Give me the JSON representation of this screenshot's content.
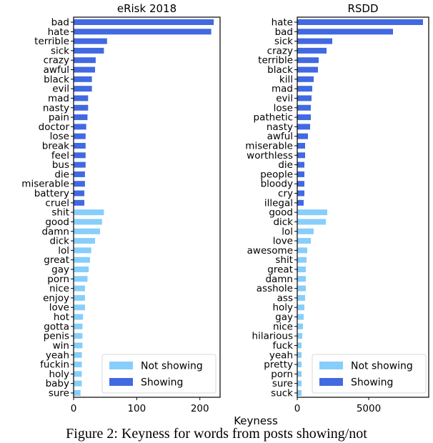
{
  "chart_data": [
    {
      "type": "bar",
      "orientation": "horizontal",
      "title": "eRisk 2018",
      "xlabel": "",
      "ylabel": "",
      "xlim": [
        0,
        232
      ],
      "xticks": [
        0,
        100,
        200
      ],
      "grid": false,
      "legend": {
        "placement": "bottom-right",
        "entries": [
          "Not showing",
          "Showing"
        ]
      },
      "categories": [
        "bad",
        "hate",
        "terrible",
        "sick",
        "crazy",
        "awful",
        "black",
        "evil",
        "mad",
        "nasty",
        "pain",
        "doctor",
        "lose",
        "break",
        "feel",
        "bus",
        "die",
        "miserable",
        "battery",
        "cruel",
        "shit",
        "good",
        "damn",
        "dick",
        "lol",
        "great",
        "gay",
        "porn",
        "nice",
        "enjoy",
        "love",
        "hot",
        "gotta",
        "penis",
        "win",
        "yeah",
        "fuckin",
        "holy",
        "baby",
        "sure"
      ],
      "values": [
        222,
        218,
        53,
        48,
        35,
        34,
        29,
        29,
        23,
        23,
        22,
        20,
        19,
        19,
        19,
        19,
        18,
        18,
        17,
        17,
        48,
        45,
        42,
        34,
        28,
        26,
        24,
        22,
        18,
        18,
        18,
        15,
        14,
        14,
        14,
        13,
        13,
        13,
        13,
        11
      ],
      "groups": [
        "Showing",
        "Showing",
        "Showing",
        "Showing",
        "Showing",
        "Showing",
        "Showing",
        "Showing",
        "Showing",
        "Showing",
        "Showing",
        "Showing",
        "Showing",
        "Showing",
        "Showing",
        "Showing",
        "Showing",
        "Showing",
        "Showing",
        "Showing",
        "Not showing",
        "Not showing",
        "Not showing",
        "Not showing",
        "Not showing",
        "Not showing",
        "Not showing",
        "Not showing",
        "Not showing",
        "Not showing",
        "Not showing",
        "Not showing",
        "Not showing",
        "Not showing",
        "Not showing",
        "Not showing",
        "Not showing",
        "Not showing",
        "Not showing",
        "Not showing"
      ]
    },
    {
      "type": "bar",
      "orientation": "horizontal",
      "title": "RSDD",
      "xlabel": "",
      "ylabel": "",
      "xlim": [
        0,
        9200
      ],
      "xticks": [
        0,
        5000
      ],
      "grid": false,
      "legend": {
        "placement": "bottom-right",
        "entries": [
          "Not showing",
          "Showing"
        ]
      },
      "categories": [
        "hate",
        "bad",
        "sick",
        "crazy",
        "terrible",
        "black",
        "kill",
        "mad",
        "evil",
        "lose",
        "pathetic",
        "nasty",
        "awful",
        "miserable",
        "worthless",
        "die",
        "people",
        "bloody",
        "cry",
        "illegal",
        "good",
        "dick",
        "lol",
        "love",
        "awesome",
        "shit",
        "great",
        "damn",
        "asshole",
        "ass",
        "holy",
        "gay",
        "nice",
        "hilarious",
        "fuck",
        "yeah",
        "pretty",
        "porn",
        "sure",
        "suck"
      ],
      "values": [
        8800,
        6700,
        2450,
        2050,
        1500,
        1450,
        1150,
        1050,
        1000,
        950,
        950,
        900,
        750,
        550,
        550,
        500,
        500,
        500,
        500,
        450,
        2100,
        2000,
        1150,
        950,
        700,
        650,
        600,
        600,
        600,
        550,
        500,
        450,
        400,
        350,
        300,
        300,
        300,
        300,
        300,
        300
      ],
      "groups": [
        "Showing",
        "Showing",
        "Showing",
        "Showing",
        "Showing",
        "Showing",
        "Showing",
        "Showing",
        "Showing",
        "Showing",
        "Showing",
        "Showing",
        "Showing",
        "Showing",
        "Showing",
        "Showing",
        "Showing",
        "Showing",
        "Showing",
        "Showing",
        "Not showing",
        "Not showing",
        "Not showing",
        "Not showing",
        "Not showing",
        "Not showing",
        "Not showing",
        "Not showing",
        "Not showing",
        "Not showing",
        "Not showing",
        "Not showing",
        "Not showing",
        "Not showing",
        "Not showing",
        "Not showing",
        "Not showing",
        "Not showing",
        "Not showing",
        "Not showing"
      ]
    }
  ],
  "shared_xlabel": "Keyness",
  "colors": {
    "Showing": "#4169e1",
    "Not showing": "#87cefa"
  },
  "caption": "Figure 2: Keyness for words from posts showing/not"
}
